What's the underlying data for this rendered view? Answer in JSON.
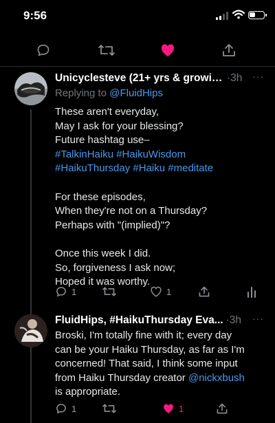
{
  "status_bar": {
    "time": "9:56"
  },
  "tweet1": {
    "author": "Unicyclesteve (21+ yrs & growin...",
    "time": "3h",
    "more": "···",
    "replying_prefix": "Replying to",
    "replying_handle": "@FluidHips",
    "lines": [
      "These aren't everyday,",
      "May I ask for your blessing?",
      "Future hashtag use–",
      [
        "#TalkinHaiku",
        " ",
        "#HaikuWisdom"
      ],
      [
        "#HaikuThursday",
        " ",
        "#Haiku",
        " ",
        "#meditate"
      ],
      "",
      "For these episodes,",
      "When they're not on a Thursday?",
      "Perhaps with \"(implied)\"?",
      "",
      "Once this week I did.",
      "So, forgiveness I ask now;",
      "Hoped it was worthy."
    ],
    "reply_count": "1",
    "like_count": "1"
  },
  "tweet2": {
    "author": "FluidHips, #HaikuThursday Eva...",
    "time": "3h",
    "more": "···",
    "text_lines": [
      "Broski, I'm totally fine with it; every day",
      "can be your Haiku Thursday, as far as I'm",
      "concerned! That said, I think some input",
      "from Haiku Thursday creator",
      "is appropriate."
    ],
    "mention": "@nickxbush",
    "reply_count": "1",
    "like_count": "1"
  },
  "colors": {
    "link": "#4a99e9",
    "like_active": "#f91880",
    "muted": "#71767b"
  }
}
